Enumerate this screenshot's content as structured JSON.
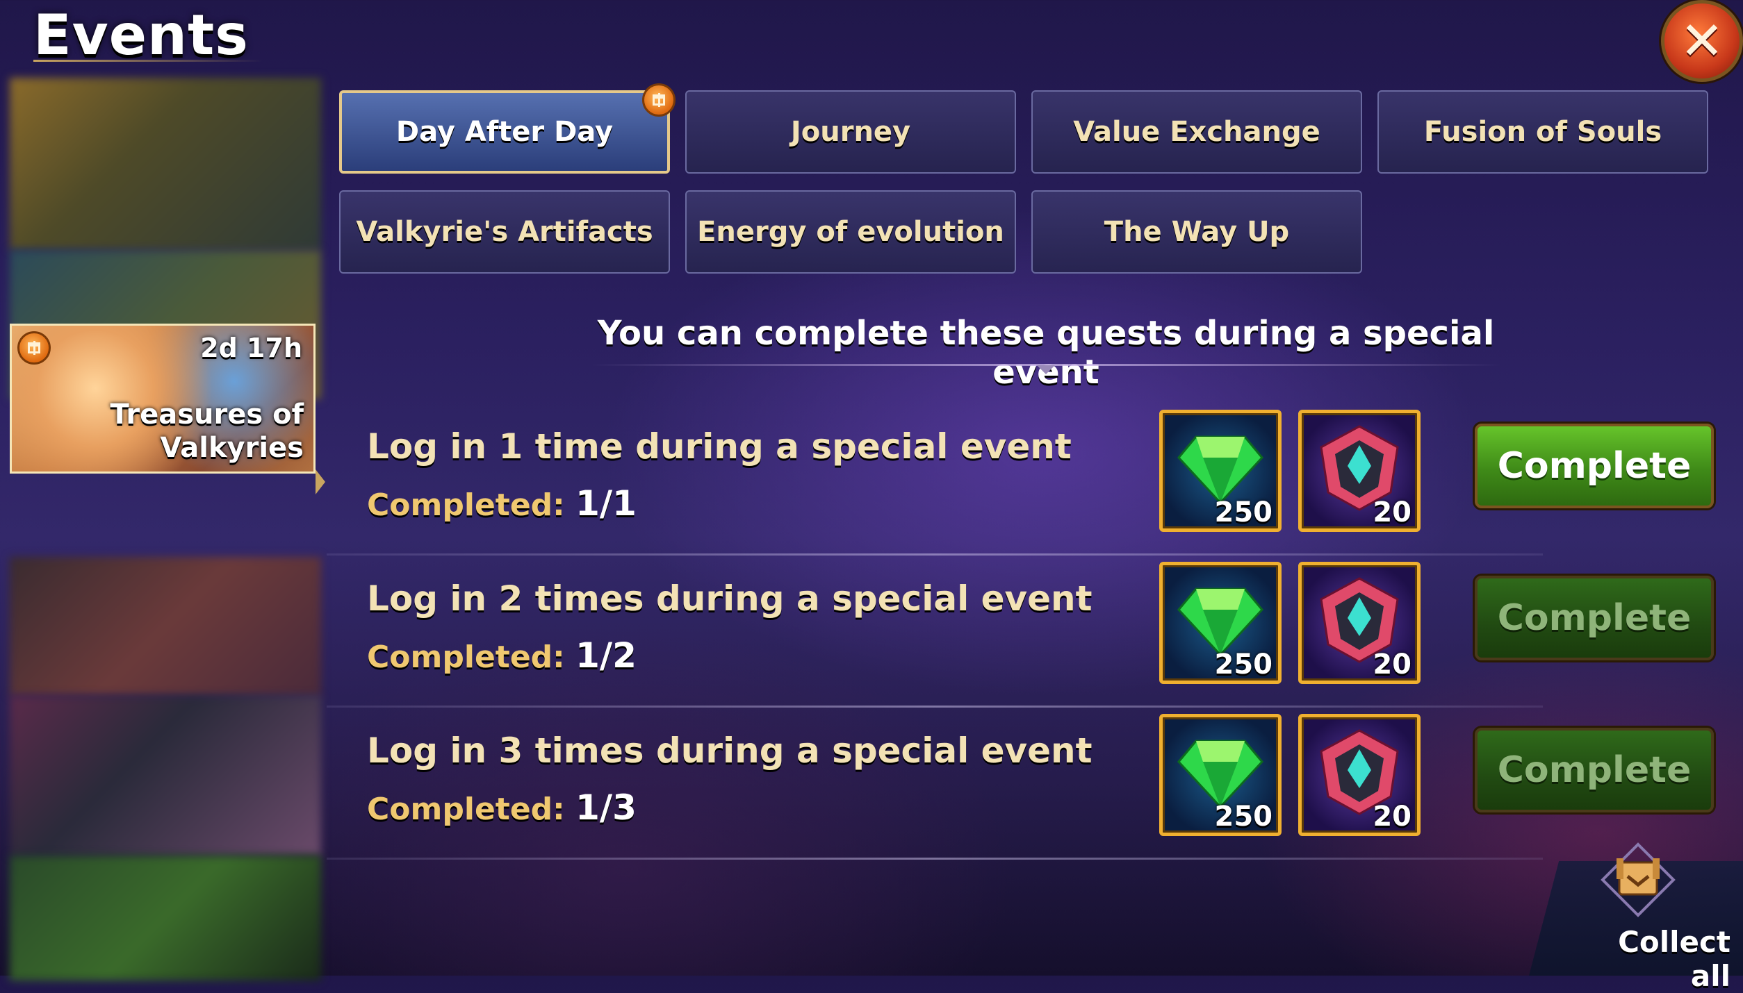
{
  "header": {
    "title": "Events",
    "close_icon": "close-icon"
  },
  "sidebar": {
    "active_event": {
      "name": "Treasures of Valkyries",
      "time_left": "2d 17h",
      "badge_icon": "gift-icon"
    }
  },
  "tabs": [
    {
      "label": "Day After Day",
      "active": true,
      "badge_icon": "gift-icon"
    },
    {
      "label": "Journey",
      "active": false
    },
    {
      "label": "Value Exchange",
      "active": false
    },
    {
      "label": "Fusion of Souls",
      "active": false
    },
    {
      "label": "Valkyrie's Artifacts",
      "active": false
    },
    {
      "label": "Energy of evolution",
      "active": false
    },
    {
      "label": "The Way Up",
      "active": false
    }
  ],
  "main": {
    "subtitle": "You can complete these quests during a special event"
  },
  "quests": [
    {
      "title": "Log in 1 time during a special event",
      "progress_label": "Completed:",
      "progress_value": "1/1",
      "rewards": [
        {
          "icon": "emerald-icon",
          "count": "250"
        },
        {
          "icon": "titan-artifact-icon",
          "count": "20"
        }
      ],
      "button_label": "Complete",
      "button_enabled": true
    },
    {
      "title": "Log in 2 times during a special event",
      "progress_label": "Completed:",
      "progress_value": "1/2",
      "rewards": [
        {
          "icon": "emerald-icon",
          "count": "250"
        },
        {
          "icon": "titan-artifact-icon",
          "count": "20"
        }
      ],
      "button_label": "Complete",
      "button_enabled": false
    },
    {
      "title": "Log in 3 times during a special event",
      "progress_label": "Completed:",
      "progress_value": "1/3",
      "rewards": [
        {
          "icon": "emerald-icon",
          "count": "250"
        },
        {
          "icon": "titan-artifact-icon",
          "count": "20"
        }
      ],
      "button_label": "Complete",
      "button_enabled": false
    }
  ],
  "footer": {
    "collect_all_label": "Collect all",
    "collect_icon": "collect-all-icon"
  },
  "colors": {
    "accent_gold": "#f0b030",
    "button_green": "#66c42a",
    "text_cream": "#f3e2b5"
  }
}
